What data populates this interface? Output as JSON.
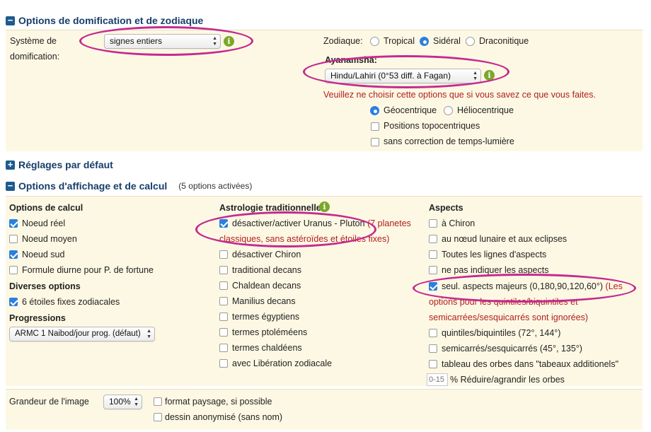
{
  "sections": {
    "domification": {
      "title": "Options de domification et de zodiaque",
      "house_system_label_1": "Système de",
      "house_system_label_2": "domification:",
      "house_system_value": "signes entiers",
      "zodiac_label": "Zodiaque:",
      "zodiac_options": [
        "Tropical",
        "Sidéral",
        "Draconitique"
      ],
      "zodiac_selected": "Sidéral",
      "ayanamsha_label": "Ayanamsha:",
      "ayanamsha_value": "Hindu/Lahiri (0°53 diff. à Fagan)",
      "warning": "Veuillez ne choisir cette options que si vous savez ce que vous faites.",
      "centric_options": [
        "Géocentrique",
        "Héliocentrique"
      ],
      "centric_selected": "Géocentrique",
      "topocentric_label": "Positions topocentriques",
      "light_time_label": "sans correction de temps-lumière"
    },
    "defaults": {
      "title": "Réglages par défaut"
    },
    "display": {
      "title": "Options d'affichage et de calcul",
      "note": "(5 options activées)",
      "calc": {
        "title": "Options de calcul",
        "items": [
          {
            "label": "Noeud réel",
            "checked": true
          },
          {
            "label": "Noeud moyen",
            "checked": false
          },
          {
            "label": "Noeud sud",
            "checked": true
          },
          {
            "label": "Formule diurne pour P. de fortune",
            "checked": false
          }
        ],
        "misc_title": "Diverses options",
        "misc_items": [
          {
            "label": "6 étoiles fixes zodiacales",
            "checked": true
          }
        ],
        "progressions_title": "Progressions",
        "progressions_value": "ARMC 1 Naibod/jour prog. (défaut)"
      },
      "traditional": {
        "title": "Astrologie traditionnelle",
        "first_item_label": "désactiver/activer Uranus - Pluton",
        "first_item_note_1": "(7 planetes",
        "first_item_note_2": "classiques, sans astéroïdes et étoiles fixes)",
        "items": [
          "désactiver Chiron",
          "traditional decans",
          "Chaldean decans",
          "Manilius decans",
          "termes égyptiens",
          "termes ptoléméens",
          "termes chaldéens",
          "avec Libération zodiacale"
        ]
      },
      "aspects": {
        "title": "Aspects",
        "items_top": [
          "à Chiron",
          "au nœud lunaire et aux eclipses",
          "Toutes les lignes d'aspects",
          "ne pas indiquer les aspects"
        ],
        "major_label": "seul. aspects majeurs (0,180,90,120,60°)",
        "major_note_1": "(Les",
        "major_note_2": "options pour les quintiles/biquintiles et",
        "major_note_3": "semicarrées/sesquicarrés sont ignorées)",
        "items_bottom": [
          "quintiles/biquintiles (72°, 144°)",
          "semicarrés/sesquicarrés (45°, 135°)",
          "tableau des orbes dans \"tabeaux additionels\""
        ],
        "orb_placeholder": "0-15",
        "orb_label": "% Réduire/agrandir les orbes"
      }
    },
    "image": {
      "size_label": "Grandeur de l'image",
      "size_value": "100%",
      "landscape_label": "format paysage, si possible",
      "anonymous_label": "dessin anonymisé (sans nom)"
    }
  },
  "colors": {
    "header": "#163e6a",
    "panel": "#fdf8e4",
    "accent_check": "#2a7fe0",
    "warning_red": "#b0201f",
    "highlight_ellipse": "#c52a8f",
    "info_green": "#7ba72b"
  }
}
